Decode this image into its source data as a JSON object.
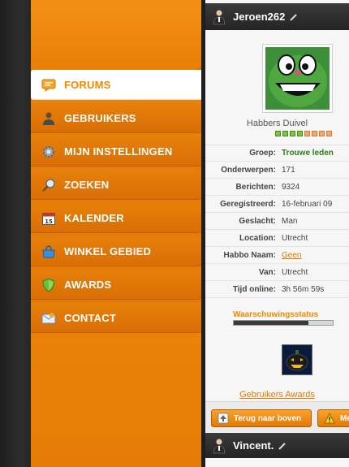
{
  "nav": {
    "items": [
      {
        "label": "FORUMS",
        "icon": "chat-bubble-icon",
        "active": true
      },
      {
        "label": "GEBRUIKERS",
        "icon": "user-icon",
        "active": false
      },
      {
        "label": "MIJN INSTELLINGEN",
        "icon": "gear-icon",
        "active": false
      },
      {
        "label": "ZOEKEN",
        "icon": "magnifier-icon",
        "active": false
      },
      {
        "label": "KALENDER",
        "icon": "calendar-icon",
        "active": false
      },
      {
        "label": "WINKEL GEBIED",
        "icon": "shop-icon",
        "active": false
      },
      {
        "label": "AWARDS",
        "icon": "shield-icon",
        "active": false
      },
      {
        "label": "CONTACT",
        "icon": "mail-icon",
        "active": false
      }
    ],
    "calendar_day": "15"
  },
  "post": {
    "username": "Jeroen262",
    "rank_name": "Habbers Duivel",
    "rank_squares": [
      "green",
      "green",
      "green",
      "green",
      "orange",
      "orange",
      "orange",
      "orange"
    ],
    "profile_rows": [
      {
        "key": "Groep:",
        "value": "Trouwe leden",
        "style": "green"
      },
      {
        "key": "Onderwerpen:",
        "value": "171",
        "style": ""
      },
      {
        "key": "Berichten:",
        "value": "9324",
        "style": ""
      },
      {
        "key": "Geregistreerd:",
        "value": "16-februari 09",
        "style": ""
      },
      {
        "key": "Geslacht:",
        "value": "Man",
        "style": ""
      },
      {
        "key": "Location:",
        "value": "Utrecht",
        "style": ""
      },
      {
        "key": "Habbo Naam:",
        "value": "Geen",
        "style": "link"
      },
      {
        "key": "Van:",
        "value": "Utrecht",
        "style": ""
      },
      {
        "key": "Tijd online:",
        "value": "3h 56m 59s",
        "style": ""
      }
    ],
    "warning_label": "Waarschuwingsstatus",
    "warning_level": 0.75,
    "awards_link": "Gebruikers Awards",
    "back_to_top": "Terug naar boven",
    "report_label": "Me"
  },
  "next_post": {
    "username": "Vincent."
  },
  "colors": {
    "accent": "#f08a00",
    "group_green": "#2e7d1d",
    "header_dark": "#2e2e2e"
  }
}
